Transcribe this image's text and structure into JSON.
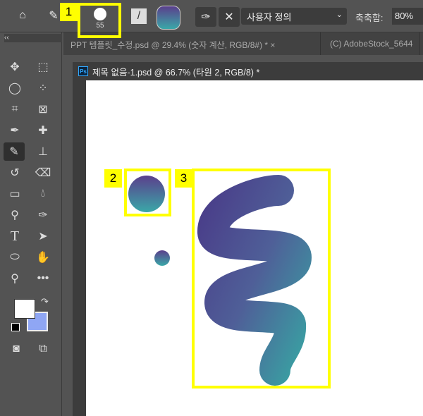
{
  "options_bar": {
    "brush_size": "55",
    "mode_select": "사용자 정의",
    "smoothing_label": "축축함:",
    "smoothing_value": "80%"
  },
  "tabs": [
    {
      "label": "PPT 템플릿_수정.psd @ 29.4% (숫자 계산, RGB/8#) *",
      "close": "×"
    },
    {
      "label": "(C) AdobeStock_5644"
    }
  ],
  "document": {
    "title": "제목 없음-1.psd @ 66.7% (타원 2, RGB/8) *",
    "badge": "Ps"
  },
  "toolbar": {
    "collapse": "‹‹"
  },
  "annotations": [
    "1",
    "2",
    "3"
  ],
  "colors": {
    "foreground": "#ffffff",
    "background": "#8fa6f4",
    "gradient_start": "#5b3f8c",
    "gradient_end": "#3aa8a8",
    "annotation": "#ffff00"
  }
}
